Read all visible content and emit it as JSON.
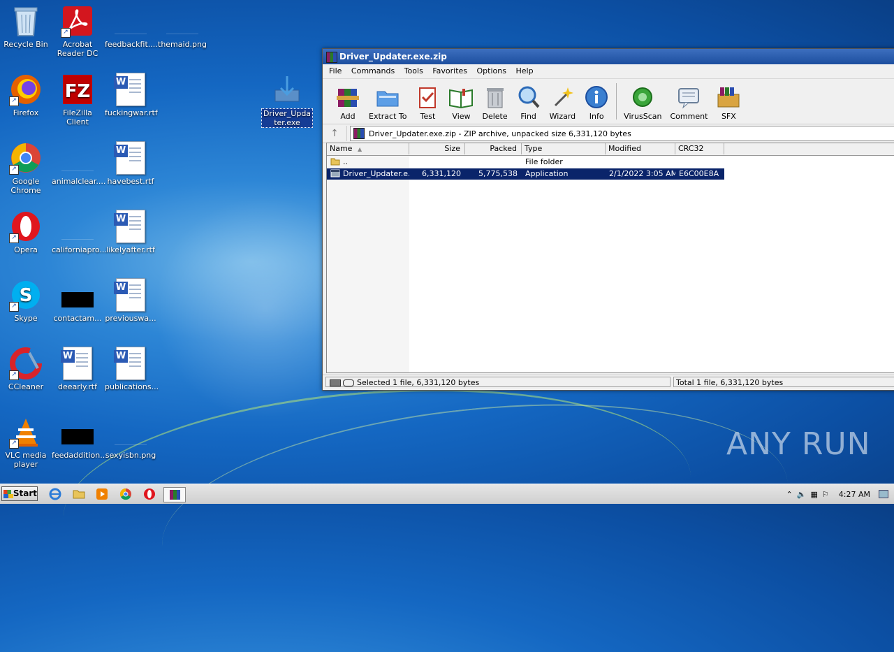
{
  "desktop": {
    "icons": [
      {
        "label": "Recycle Bin"
      },
      {
        "label": "Acrobat Reader DC"
      },
      {
        "label": "feedbackfit...."
      },
      {
        "label": "themaid.png"
      },
      {
        "label": "Firefox"
      },
      {
        "label": "FileZilla Client"
      },
      {
        "label": "fuckingwar.rtf"
      },
      {
        "label": "Driver_Updater.exe"
      },
      {
        "label": "Google Chrome"
      },
      {
        "label": "animalclear...."
      },
      {
        "label": "havebest.rtf"
      },
      {
        "label": "Opera"
      },
      {
        "label": "californiapro..."
      },
      {
        "label": "likelyafter.rtf"
      },
      {
        "label": "Skype"
      },
      {
        "label": "contactam..."
      },
      {
        "label": "previouswa..."
      },
      {
        "label": "CCleaner"
      },
      {
        "label": "deearly.rtf"
      },
      {
        "label": "publications..."
      },
      {
        "label": "VLC media player"
      },
      {
        "label": "feedaddition..."
      },
      {
        "label": "sexyisbn.png"
      }
    ]
  },
  "window": {
    "title": "Driver_Updater.exe.zip",
    "menu": [
      "File",
      "Commands",
      "Tools",
      "Favorites",
      "Options",
      "Help"
    ],
    "toolbar": [
      "Add",
      "Extract To",
      "Test",
      "View",
      "Delete",
      "Find",
      "Wizard",
      "Info",
      "VirusScan",
      "Comment",
      "SFX"
    ],
    "address": "Driver_Updater.exe.zip - ZIP archive, unpacked size 6,331,120 bytes",
    "columns": [
      "Name",
      "Size",
      "Packed",
      "Type",
      "Modified",
      "CRC32"
    ],
    "rows": [
      {
        "name": "..",
        "size": "",
        "packed": "",
        "type": "File folder",
        "modified": "",
        "crc": ""
      },
      {
        "name": "Driver_Updater.e...",
        "size": "6,331,120",
        "packed": "5,775,538",
        "type": "Application",
        "modified": "2/1/2022 3:05 AM",
        "crc": "E6C00E8A"
      }
    ],
    "status_left": "Selected 1 file, 6,331,120 bytes",
    "status_right": "Total 1 file, 6,331,120 bytes"
  },
  "taskbar": {
    "start_label": "Start",
    "clock": "4:27 AM"
  },
  "watermark": "ANY RUN"
}
